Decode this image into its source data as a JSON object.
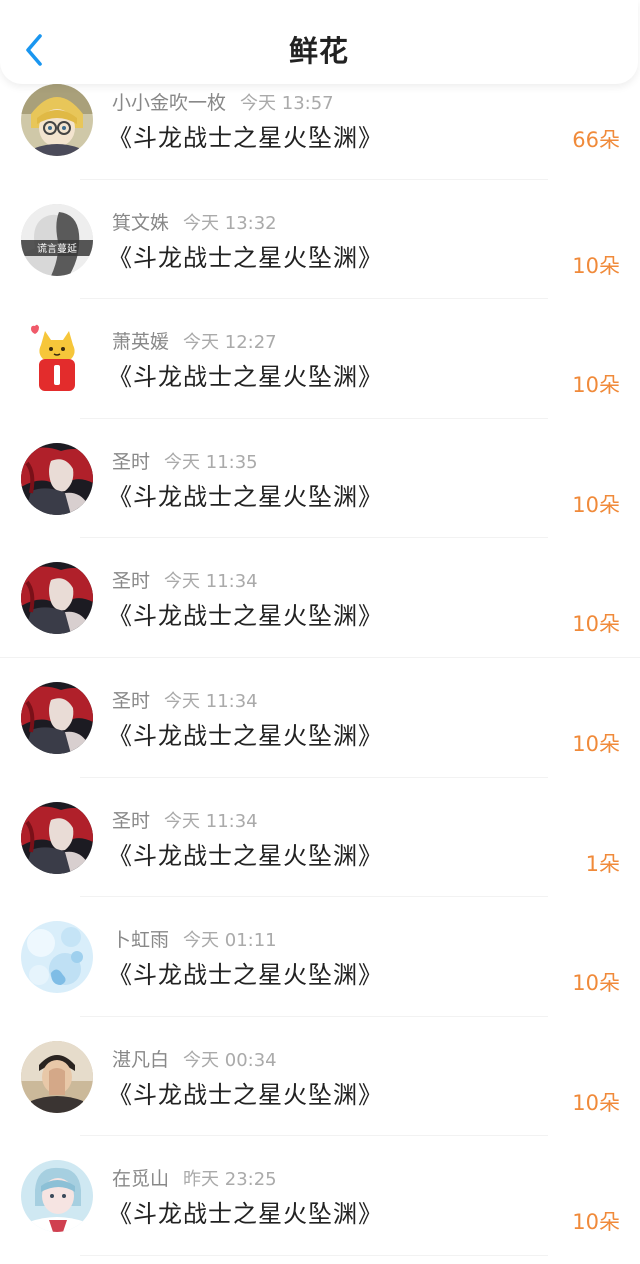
{
  "header": {
    "title": "鲜花",
    "back_icon": "chevron-left-icon",
    "accent_color": "#1a96f0"
  },
  "colors": {
    "flower_count": "#f08a3a",
    "meta_text": "#888888"
  },
  "records": [
    {
      "user": "小小金吹一枚",
      "time": "今天 13:57",
      "book": "《斗龙战士之星火坠渊》",
      "flowers": "66朵",
      "avatar": "anime-blonde-avatar"
    },
    {
      "user": "箕文姝",
      "time": "今天 13:32",
      "book": "《斗龙战士之星火坠渊》",
      "flowers": "10朵",
      "avatar": "grayscale-photo-avatar",
      "avatar_text": "谎言蔓延"
    },
    {
      "user": "萧英媛",
      "time": "今天 12:27",
      "book": "《斗龙战士之星火坠渊》",
      "flowers": "10朵",
      "avatar": "yellow-cat-avatar"
    },
    {
      "user": "圣时",
      "time": "今天 11:35",
      "book": "《斗龙战士之星火坠渊》",
      "flowers": "10朵",
      "avatar": "red-hair-anime-avatar"
    },
    {
      "user": "圣时",
      "time": "今天 11:34",
      "book": "《斗龙战士之星火坠渊》",
      "flowers": "10朵",
      "avatar": "red-hair-anime-avatar"
    },
    {
      "user": "圣时",
      "time": "今天 11:34",
      "book": "《斗龙战士之星火坠渊》",
      "flowers": "10朵",
      "avatar": "red-hair-anime-avatar"
    },
    {
      "user": "圣时",
      "time": "今天 11:34",
      "book": "《斗龙战士之星火坠渊》",
      "flowers": "1朵",
      "avatar": "red-hair-anime-avatar"
    },
    {
      "user": "卜虹雨",
      "time": "今天 01:11",
      "book": "《斗龙战士之星火坠渊》",
      "flowers": "10朵",
      "avatar": "light-blue-bokeh-avatar"
    },
    {
      "user": "湛凡白",
      "time": "今天 00:34",
      "book": "《斗龙战士之星火坠渊》",
      "flowers": "10朵",
      "avatar": "boy-photo-avatar"
    },
    {
      "user": "在觅山",
      "time": "昨天 23:25",
      "book": "《斗龙战士之星火坠渊》",
      "flowers": "10朵",
      "avatar": "girl-photo-avatar"
    }
  ]
}
